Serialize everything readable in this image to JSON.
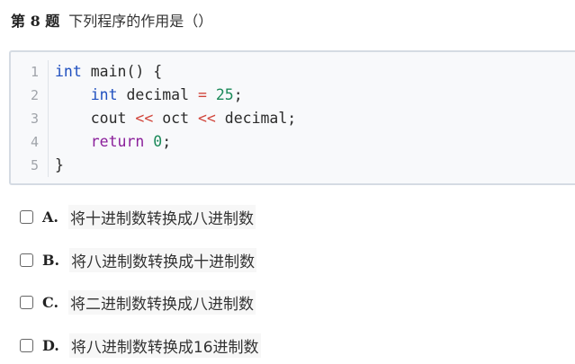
{
  "question": {
    "number_label": "第 8 题",
    "text": "下列程序的作用是（）"
  },
  "code": {
    "line_numbers": [
      "1",
      "2",
      "3",
      "4",
      "5"
    ],
    "lines": [
      [
        {
          "t": "int",
          "c": "kw"
        },
        {
          "t": " main() {",
          "c": "plain"
        }
      ],
      [
        {
          "t": "    ",
          "c": "plain"
        },
        {
          "t": "int",
          "c": "kw"
        },
        {
          "t": " decimal ",
          "c": "plain"
        },
        {
          "t": "=",
          "c": "op"
        },
        {
          "t": " ",
          "c": "plain"
        },
        {
          "t": "25",
          "c": "num"
        },
        {
          "t": ";",
          "c": "plain"
        }
      ],
      [
        {
          "t": "    cout ",
          "c": "plain"
        },
        {
          "t": "<<",
          "c": "op"
        },
        {
          "t": " oct ",
          "c": "plain"
        },
        {
          "t": "<<",
          "c": "op"
        },
        {
          "t": " decimal;",
          "c": "plain"
        }
      ],
      [
        {
          "t": "    ",
          "c": "plain"
        },
        {
          "t": "return",
          "c": "ret"
        },
        {
          "t": " ",
          "c": "plain"
        },
        {
          "t": "0",
          "c": "num"
        },
        {
          "t": ";",
          "c": "plain"
        }
      ],
      [
        {
          "t": "}",
          "c": "plain"
        }
      ]
    ]
  },
  "options": [
    {
      "letter": "A.",
      "text": "将十进制数转换成八进制数",
      "checked": false
    },
    {
      "letter": "B.",
      "text": "将八进制数转换成十进制数",
      "checked": false
    },
    {
      "letter": "C.",
      "text": "将二进制数转换成八进制数",
      "checked": false
    },
    {
      "letter": "D.",
      "text": "将八进制数转换成16进制数",
      "checked": false
    }
  ],
  "colors": {
    "keyword": "#1f4fbf",
    "return_keyword": "#8a1e9a",
    "number": "#1c8a5a",
    "operator": "#d1453b",
    "code_background": "#f8f9fb",
    "code_border": "#d5dbe3"
  }
}
